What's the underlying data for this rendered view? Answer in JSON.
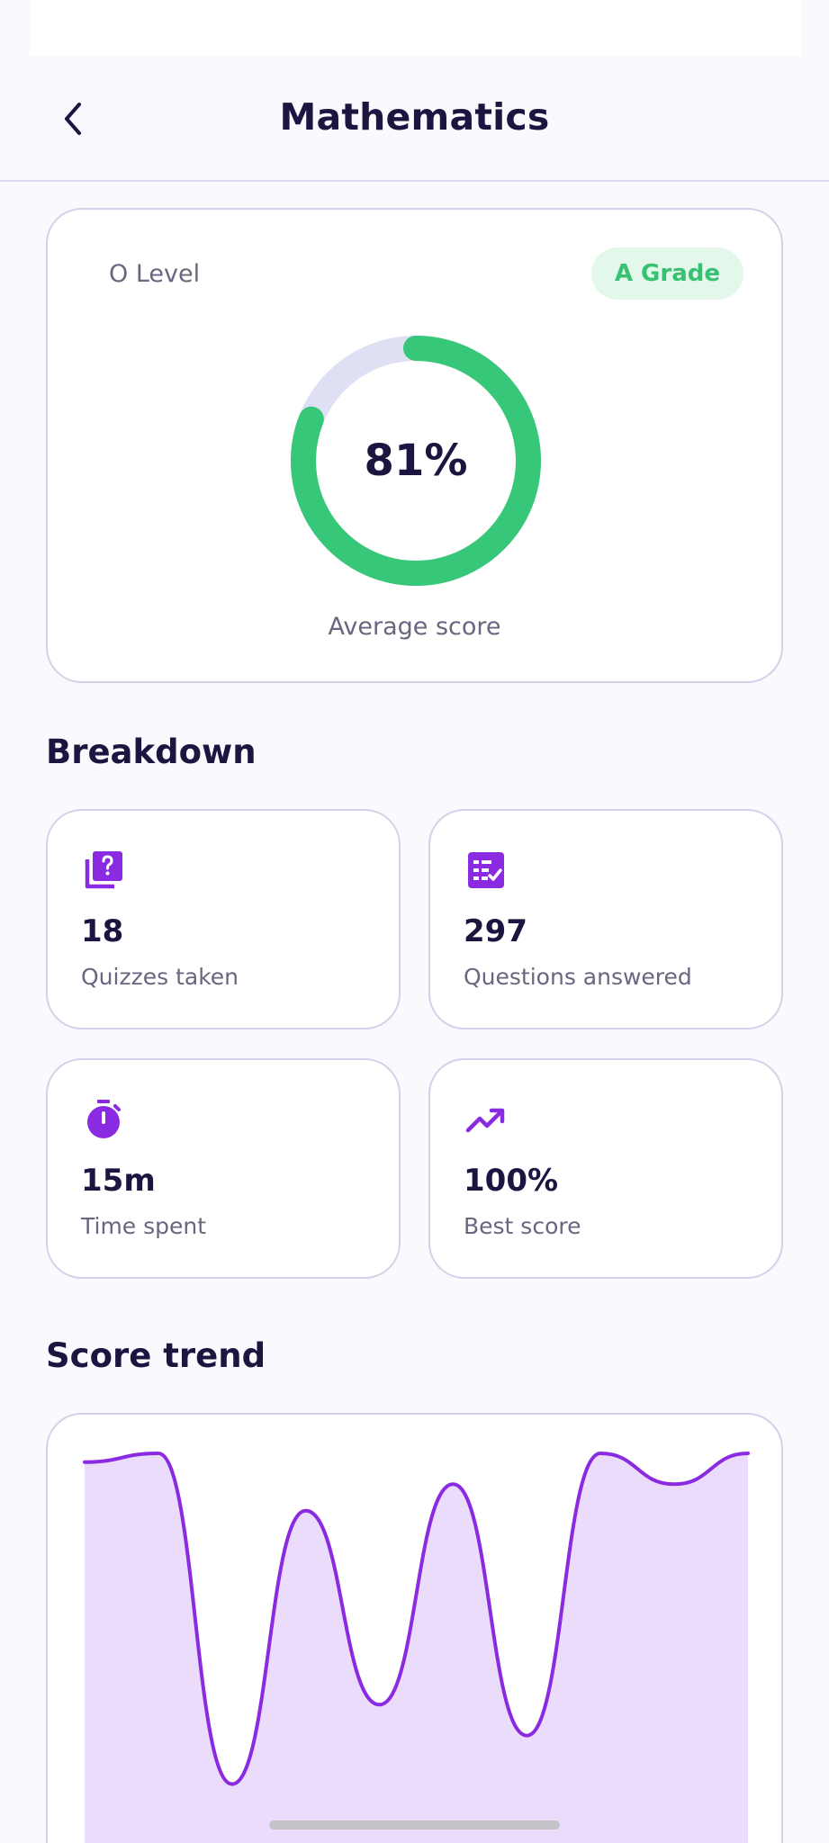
{
  "header": {
    "title": "Mathematics"
  },
  "summary": {
    "level": "O Level",
    "grade": "A Grade",
    "average_score_text": "81%",
    "average_score_fraction": 0.81,
    "caption": "Average score",
    "colors": {
      "ring": "#36c779",
      "ring_track": "#dfe0f3",
      "badge_bg": "#e3f7ea",
      "badge_text": "#36c173"
    }
  },
  "breakdown": {
    "title": "Breakdown",
    "stats": [
      {
        "icon": "quiz-icon",
        "value": "18",
        "label": "Quizzes taken"
      },
      {
        "icon": "checklist-icon",
        "value": "297",
        "label": "Questions answered"
      },
      {
        "icon": "stopwatch-icon",
        "value": "15m",
        "label": "Time spent"
      },
      {
        "icon": "trending-up-icon",
        "value": "100%",
        "label": "Best score"
      }
    ],
    "accent": "#8a2be2"
  },
  "trend": {
    "title": "Score trend",
    "chart_data": {
      "type": "area",
      "x": [
        1,
        2,
        3,
        4,
        5,
        6,
        7,
        8,
        9,
        10
      ],
      "values": [
        98,
        100,
        25,
        87,
        43,
        93,
        36,
        100,
        93,
        100
      ],
      "ylim": [
        0,
        100
      ],
      "colors": {
        "line": "#8a2be2",
        "fill": "#ecdcfb"
      }
    }
  }
}
